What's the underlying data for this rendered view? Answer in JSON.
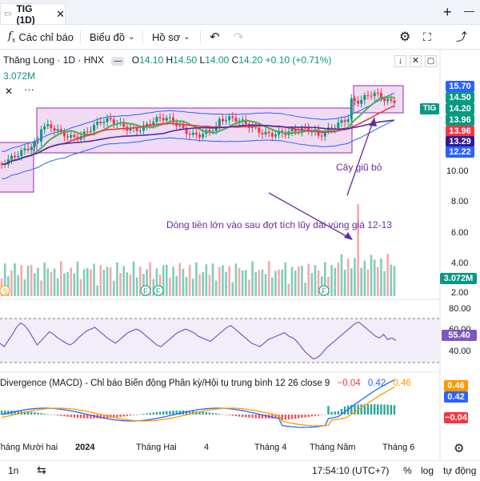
{
  "tab": {
    "title": "TIG (1D)",
    "close_icon": "close-icon"
  },
  "window": {
    "new_tab_symbol": "+",
    "minimize_symbol": "—"
  },
  "toolbar": {
    "indicators_label": "Các chỉ báo",
    "chart_type_label": "Biểu đồ",
    "profile_label": "Hồ sơ"
  },
  "symbol_legend": {
    "name": "Thăng Long · 1D · HNX",
    "open_k": "O",
    "open_v": "14.10",
    "high_k": "H",
    "high_v": "14.50",
    "low_k": "L",
    "low_v": "14.00",
    "close_k": "C",
    "close_v": "14.20",
    "change": "+0.10 (+0.71%)",
    "volume": "3.072M"
  },
  "price_axis": {
    "labels": [
      {
        "text": "15.70",
        "color": "#2962ff"
      },
      {
        "text": "14.50",
        "color": "#089981"
      },
      {
        "text": "14.20",
        "color": "#089981"
      },
      {
        "text": "13.96",
        "color": "#089981"
      },
      {
        "text": "13.96",
        "color": "#f23645"
      },
      {
        "text": "13.29",
        "color": "#311b92"
      },
      {
        "text": "12.22",
        "color": "#2962ff"
      }
    ],
    "ticker_badge": "TIG",
    "ticks": [
      "10.00",
      "8.00",
      "6.00",
      "4.00",
      "2.00"
    ],
    "volume_badge": "3.072M"
  },
  "annotations": {
    "hammer": "Cây giũ bỏ",
    "money_flow": "Dòng tiền lớn vào sau đợt tích lũy dài vùng giá 12-13"
  },
  "rsi": {
    "ticks": [
      "80.00",
      "60.00",
      "40.00"
    ],
    "value": "55.40",
    "values": [
      52,
      48,
      55,
      62,
      70,
      75,
      72,
      66,
      58,
      50,
      55,
      60,
      65,
      62,
      58,
      55,
      52,
      50,
      53,
      58,
      62,
      66,
      68,
      70,
      66,
      62,
      58,
      55,
      52,
      56,
      60,
      64,
      66,
      68,
      66,
      62,
      58,
      54,
      50,
      48,
      52,
      56,
      60,
      64,
      66,
      68,
      66,
      64,
      60,
      58,
      56,
      54,
      58,
      62,
      66,
      70,
      72,
      68,
      64,
      60,
      56,
      52,
      50,
      48,
      52,
      56,
      58,
      60,
      62,
      64,
      60,
      58,
      54,
      48,
      42,
      38,
      34,
      36,
      40,
      46,
      50,
      54,
      58,
      62,
      66,
      70,
      74,
      76,
      72,
      68,
      64,
      60,
      58,
      62,
      56,
      58,
      55
    ]
  },
  "macd": {
    "label": "Divergence (MACD) - Chỉ báo Biến động Phân kỳ/Hội tụ trung bình 12 26 close 9",
    "v1": "−0.04",
    "v2": "0.42",
    "v3": "0.46",
    "axis_labels": [
      {
        "text": "0.46",
        "color": "#ff9800"
      },
      {
        "text": "0.42",
        "color": "#2962ff"
      },
      {
        "text": "−0.04",
        "color": "#f23645"
      }
    ]
  },
  "time_axis": [
    "Tháng Mười hai",
    "2024",
    "Tháng Hai",
    "4",
    "Tháng 4",
    "Tháng Năm",
    "Tháng 6"
  ],
  "bottom_bar": {
    "interval": "1n",
    "clock": "17:54:10 (UTC+7)",
    "percent": "%",
    "log": "log",
    "auto": "tự động"
  },
  "colors": {
    "up": "#089981",
    "down": "#f23645",
    "accent": "#2962ff",
    "box_fill": "#e1bee7",
    "box_stroke": "#9c27b0",
    "annotation": "#6a2c9c"
  }
}
